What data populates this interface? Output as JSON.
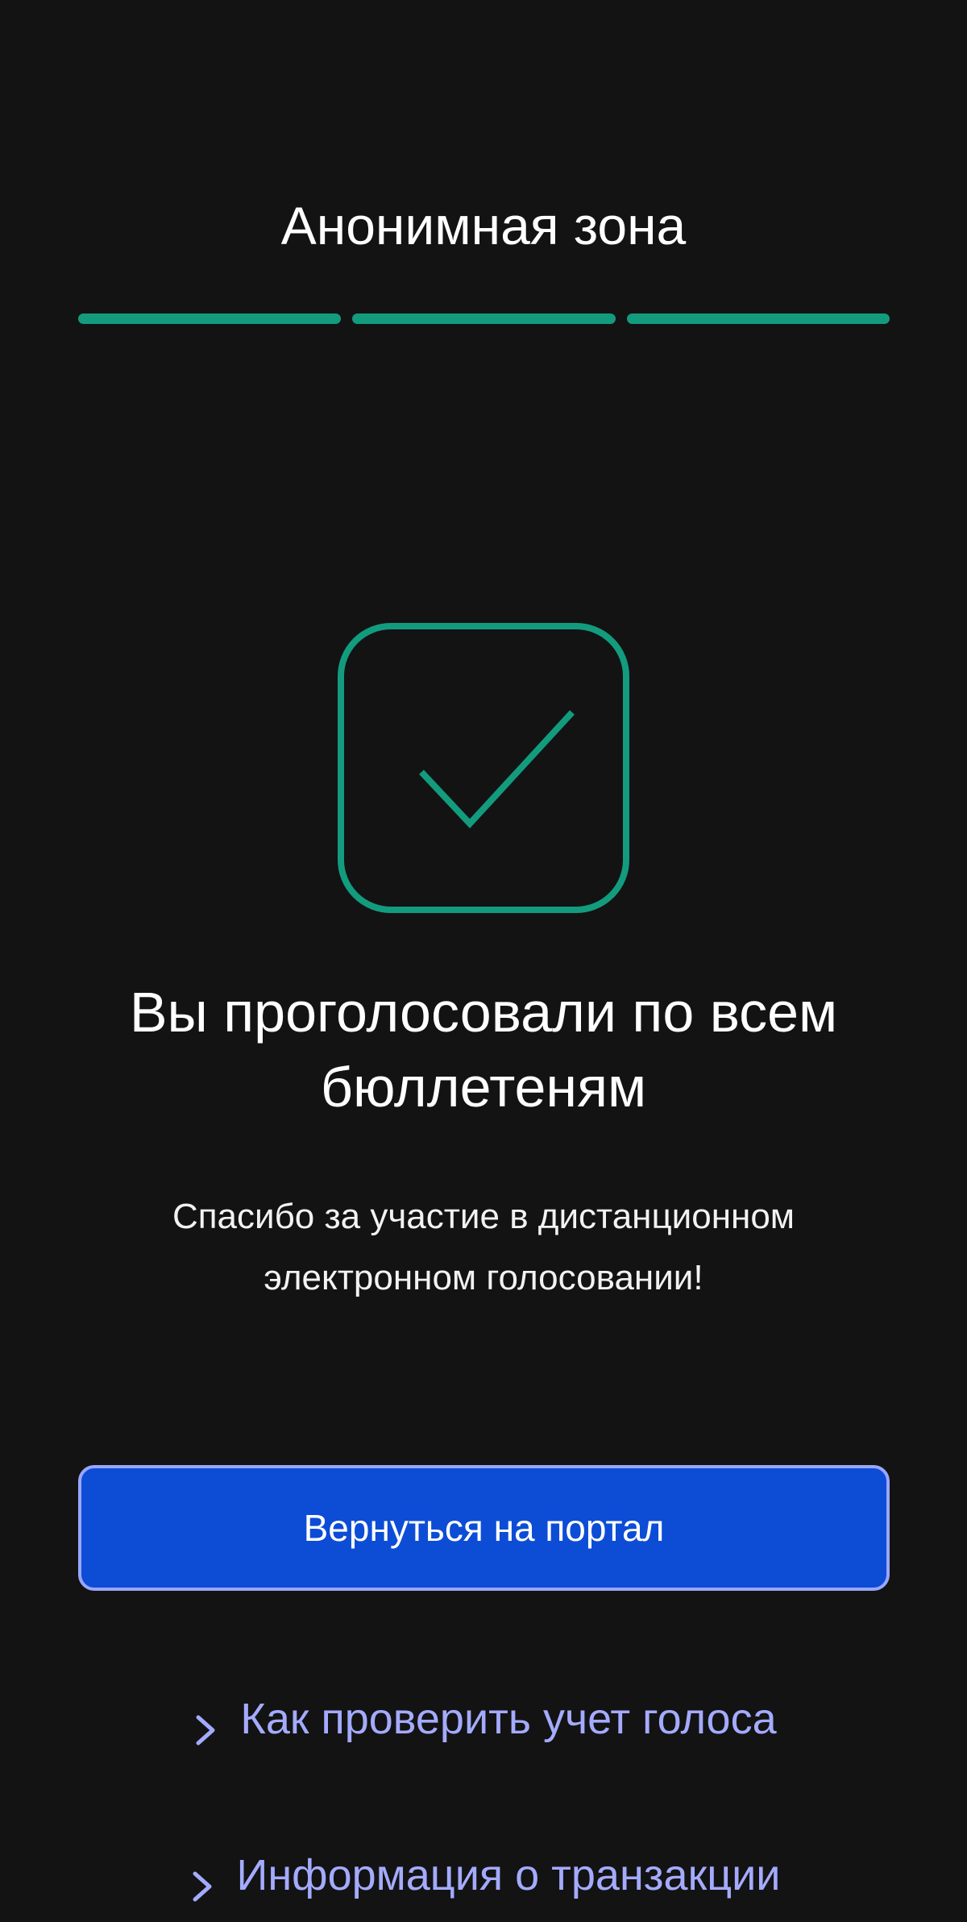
{
  "header": {
    "title": "Анонимная зона"
  },
  "progress": {
    "total_steps": 3,
    "completed_steps": 3,
    "color": "#139b7e"
  },
  "success": {
    "icon": "checkmark-icon",
    "color": "#139b7e",
    "heading": "Вы проголосовали по всем бюллетеням",
    "message": "Спасибо за участие в дистанционном электронном голосовании!"
  },
  "actions": {
    "return_label": "Вернуться на портал",
    "button_color": "#0d4dd6",
    "button_border": "#9aa6ff"
  },
  "links": {
    "color": "#a4abff",
    "icon": "chevron-right-icon",
    "verify_vote": "Как проверить учет голоса",
    "transaction_info": "Информация о транзакции"
  }
}
